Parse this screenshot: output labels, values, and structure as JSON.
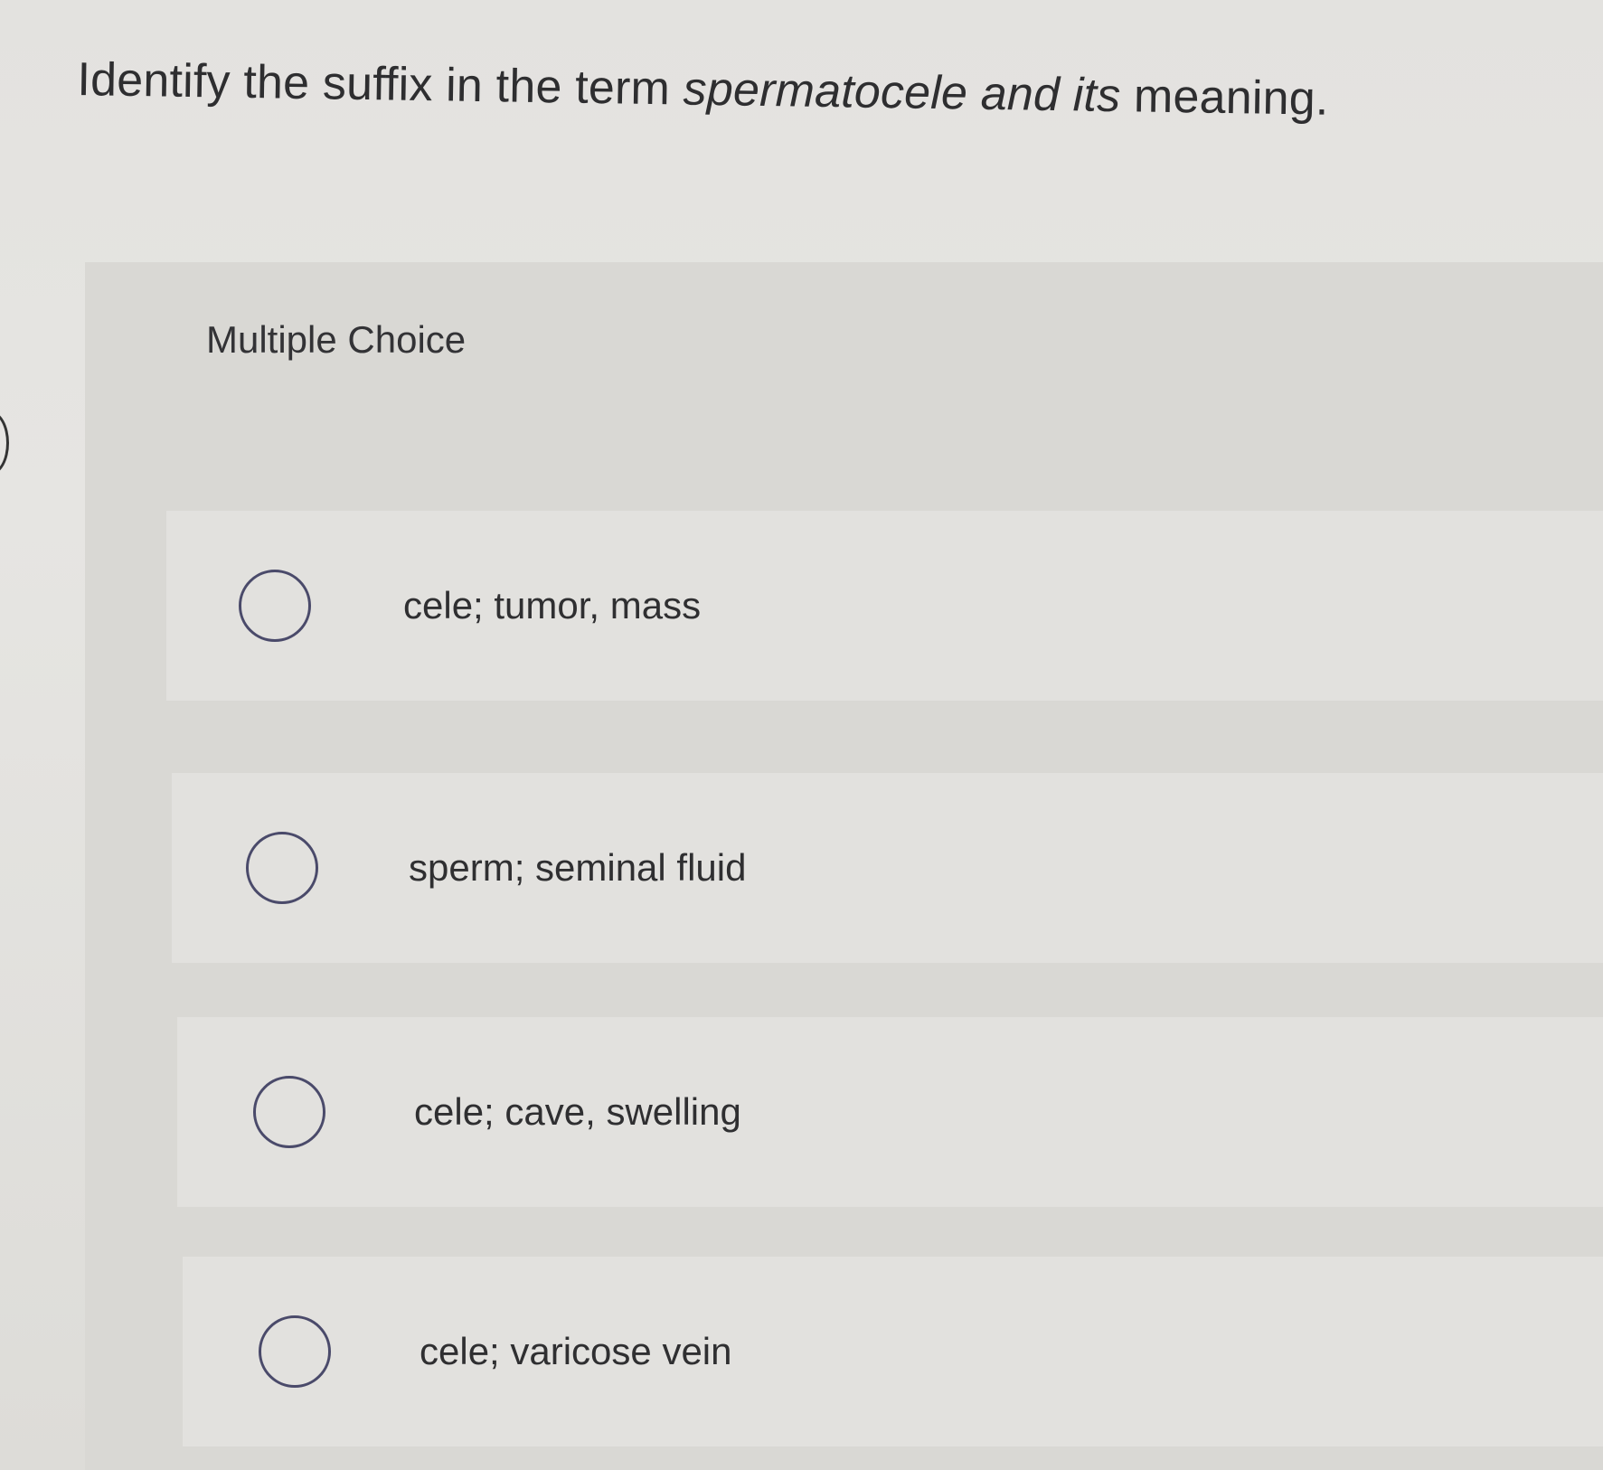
{
  "question": {
    "prefix": "Identify the suffix in the term ",
    "term": "spermatocele and its",
    "suffix": " meaning."
  },
  "multiple_choice_label": "Multiple Choice",
  "options": [
    {
      "label": "cele; tumor, mass",
      "selected": false
    },
    {
      "label": "sperm; seminal fluid",
      "selected": false
    },
    {
      "label": "cele; cave, swelling",
      "selected": false
    },
    {
      "label": "cele; varicose vein",
      "selected": false
    }
  ]
}
